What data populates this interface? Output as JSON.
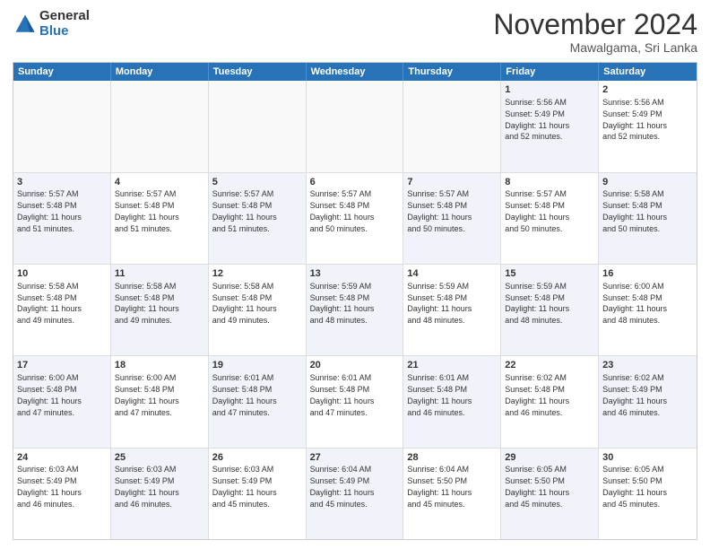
{
  "logo": {
    "general": "General",
    "blue": "Blue"
  },
  "header": {
    "month": "November 2024",
    "location": "Mawalgama, Sri Lanka"
  },
  "weekdays": [
    "Sunday",
    "Monday",
    "Tuesday",
    "Wednesday",
    "Thursday",
    "Friday",
    "Saturday"
  ],
  "rows": [
    [
      {
        "day": "",
        "info": "",
        "empty": true
      },
      {
        "day": "",
        "info": "",
        "empty": true
      },
      {
        "day": "",
        "info": "",
        "empty": true
      },
      {
        "day": "",
        "info": "",
        "empty": true
      },
      {
        "day": "",
        "info": "",
        "empty": true
      },
      {
        "day": "1",
        "shaded": true,
        "info": "Sunrise: 5:56 AM\nSunset: 5:49 PM\nDaylight: 11 hours\nand 52 minutes."
      },
      {
        "day": "2",
        "info": "Sunrise: 5:56 AM\nSunset: 5:49 PM\nDaylight: 11 hours\nand 52 minutes."
      }
    ],
    [
      {
        "day": "3",
        "shaded": true,
        "info": "Sunrise: 5:57 AM\nSunset: 5:48 PM\nDaylight: 11 hours\nand 51 minutes."
      },
      {
        "day": "4",
        "info": "Sunrise: 5:57 AM\nSunset: 5:48 PM\nDaylight: 11 hours\nand 51 minutes."
      },
      {
        "day": "5",
        "shaded": true,
        "info": "Sunrise: 5:57 AM\nSunset: 5:48 PM\nDaylight: 11 hours\nand 51 minutes."
      },
      {
        "day": "6",
        "info": "Sunrise: 5:57 AM\nSunset: 5:48 PM\nDaylight: 11 hours\nand 50 minutes."
      },
      {
        "day": "7",
        "shaded": true,
        "info": "Sunrise: 5:57 AM\nSunset: 5:48 PM\nDaylight: 11 hours\nand 50 minutes."
      },
      {
        "day": "8",
        "info": "Sunrise: 5:57 AM\nSunset: 5:48 PM\nDaylight: 11 hours\nand 50 minutes."
      },
      {
        "day": "9",
        "shaded": true,
        "info": "Sunrise: 5:58 AM\nSunset: 5:48 PM\nDaylight: 11 hours\nand 50 minutes."
      }
    ],
    [
      {
        "day": "10",
        "info": "Sunrise: 5:58 AM\nSunset: 5:48 PM\nDaylight: 11 hours\nand 49 minutes."
      },
      {
        "day": "11",
        "shaded": true,
        "info": "Sunrise: 5:58 AM\nSunset: 5:48 PM\nDaylight: 11 hours\nand 49 minutes."
      },
      {
        "day": "12",
        "info": "Sunrise: 5:58 AM\nSunset: 5:48 PM\nDaylight: 11 hours\nand 49 minutes."
      },
      {
        "day": "13",
        "shaded": true,
        "info": "Sunrise: 5:59 AM\nSunset: 5:48 PM\nDaylight: 11 hours\nand 48 minutes."
      },
      {
        "day": "14",
        "info": "Sunrise: 5:59 AM\nSunset: 5:48 PM\nDaylight: 11 hours\nand 48 minutes."
      },
      {
        "day": "15",
        "shaded": true,
        "info": "Sunrise: 5:59 AM\nSunset: 5:48 PM\nDaylight: 11 hours\nand 48 minutes."
      },
      {
        "day": "16",
        "info": "Sunrise: 6:00 AM\nSunset: 5:48 PM\nDaylight: 11 hours\nand 48 minutes."
      }
    ],
    [
      {
        "day": "17",
        "shaded": true,
        "info": "Sunrise: 6:00 AM\nSunset: 5:48 PM\nDaylight: 11 hours\nand 47 minutes."
      },
      {
        "day": "18",
        "info": "Sunrise: 6:00 AM\nSunset: 5:48 PM\nDaylight: 11 hours\nand 47 minutes."
      },
      {
        "day": "19",
        "shaded": true,
        "info": "Sunrise: 6:01 AM\nSunset: 5:48 PM\nDaylight: 11 hours\nand 47 minutes."
      },
      {
        "day": "20",
        "info": "Sunrise: 6:01 AM\nSunset: 5:48 PM\nDaylight: 11 hours\nand 47 minutes."
      },
      {
        "day": "21",
        "shaded": true,
        "info": "Sunrise: 6:01 AM\nSunset: 5:48 PM\nDaylight: 11 hours\nand 46 minutes."
      },
      {
        "day": "22",
        "info": "Sunrise: 6:02 AM\nSunset: 5:48 PM\nDaylight: 11 hours\nand 46 minutes."
      },
      {
        "day": "23",
        "shaded": true,
        "info": "Sunrise: 6:02 AM\nSunset: 5:49 PM\nDaylight: 11 hours\nand 46 minutes."
      }
    ],
    [
      {
        "day": "24",
        "info": "Sunrise: 6:03 AM\nSunset: 5:49 PM\nDaylight: 11 hours\nand 46 minutes."
      },
      {
        "day": "25",
        "shaded": true,
        "info": "Sunrise: 6:03 AM\nSunset: 5:49 PM\nDaylight: 11 hours\nand 46 minutes."
      },
      {
        "day": "26",
        "info": "Sunrise: 6:03 AM\nSunset: 5:49 PM\nDaylight: 11 hours\nand 45 minutes."
      },
      {
        "day": "27",
        "shaded": true,
        "info": "Sunrise: 6:04 AM\nSunset: 5:49 PM\nDaylight: 11 hours\nand 45 minutes."
      },
      {
        "day": "28",
        "info": "Sunrise: 6:04 AM\nSunset: 5:50 PM\nDaylight: 11 hours\nand 45 minutes."
      },
      {
        "day": "29",
        "shaded": true,
        "info": "Sunrise: 6:05 AM\nSunset: 5:50 PM\nDaylight: 11 hours\nand 45 minutes."
      },
      {
        "day": "30",
        "info": "Sunrise: 6:05 AM\nSunset: 5:50 PM\nDaylight: 11 hours\nand 45 minutes."
      }
    ]
  ]
}
